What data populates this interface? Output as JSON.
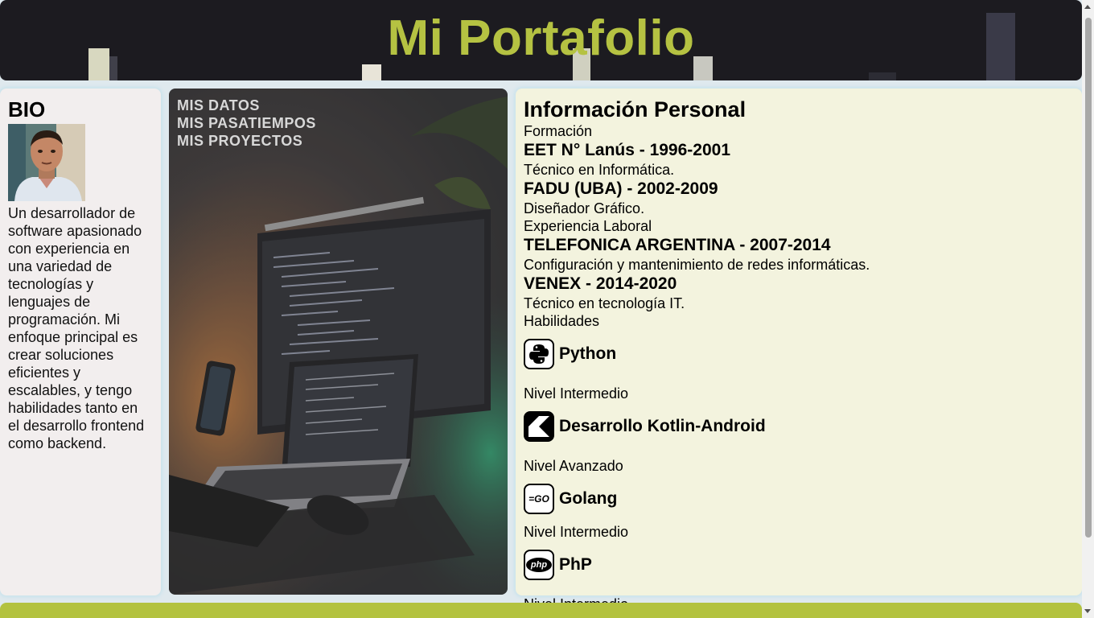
{
  "header": {
    "title": "Mi Portafolio"
  },
  "bio": {
    "heading": "BIO",
    "text": "Un desarrollador de software apasionado con experiencia en una variedad de tecnologías y lenguajes de programación. Mi enfoque principal es crear soluciones eficientes y escalables, y tengo habilidades tanto en el desarrollo frontend como backend."
  },
  "nav": {
    "items": [
      {
        "label": "MIS DATOS"
      },
      {
        "label": "MIS PASATIEMPOS"
      },
      {
        "label": "MIS PROYECTOS"
      }
    ]
  },
  "info": {
    "title": "Información Personal",
    "formacion_label": "Formación",
    "education": [
      {
        "title": "EET N° Lanús - 1996-2001",
        "desc": "Técnico en Informática."
      },
      {
        "title": "FADU (UBA) - 2002-2009",
        "desc": "Diseñador Gráfico."
      }
    ],
    "experiencia_label": "Experiencia Laboral",
    "experience": [
      {
        "title": "TELEFONICA ARGENTINA - 2007-2014",
        "desc": "Configuración y mantenimiento de redes informáticas."
      },
      {
        "title": "VENEX - 2014-2020",
        "desc": "Técnico en tecnología IT."
      }
    ],
    "habilidades_label": "Habilidades",
    "skills": [
      {
        "name": "Python",
        "level": "Nivel Intermedio",
        "icon": "python-icon"
      },
      {
        "name": "Desarrollo Kotlin-Android",
        "level": "Nivel Avanzado",
        "icon": "kotlin-icon"
      },
      {
        "name": "Golang",
        "level": "Nivel Intermedio",
        "icon": "golang-icon",
        "icon_text": "=GO"
      },
      {
        "name": "PhP",
        "level": "Nivel Intermedio",
        "icon": "php-icon",
        "icon_text": "php"
      }
    ]
  },
  "colors": {
    "accent": "#b5c242",
    "header_bg": "#1c1b20",
    "bio_bg": "#f2eeee",
    "info_bg": "#f3f3de",
    "footer_bg": "#b3c23f"
  }
}
